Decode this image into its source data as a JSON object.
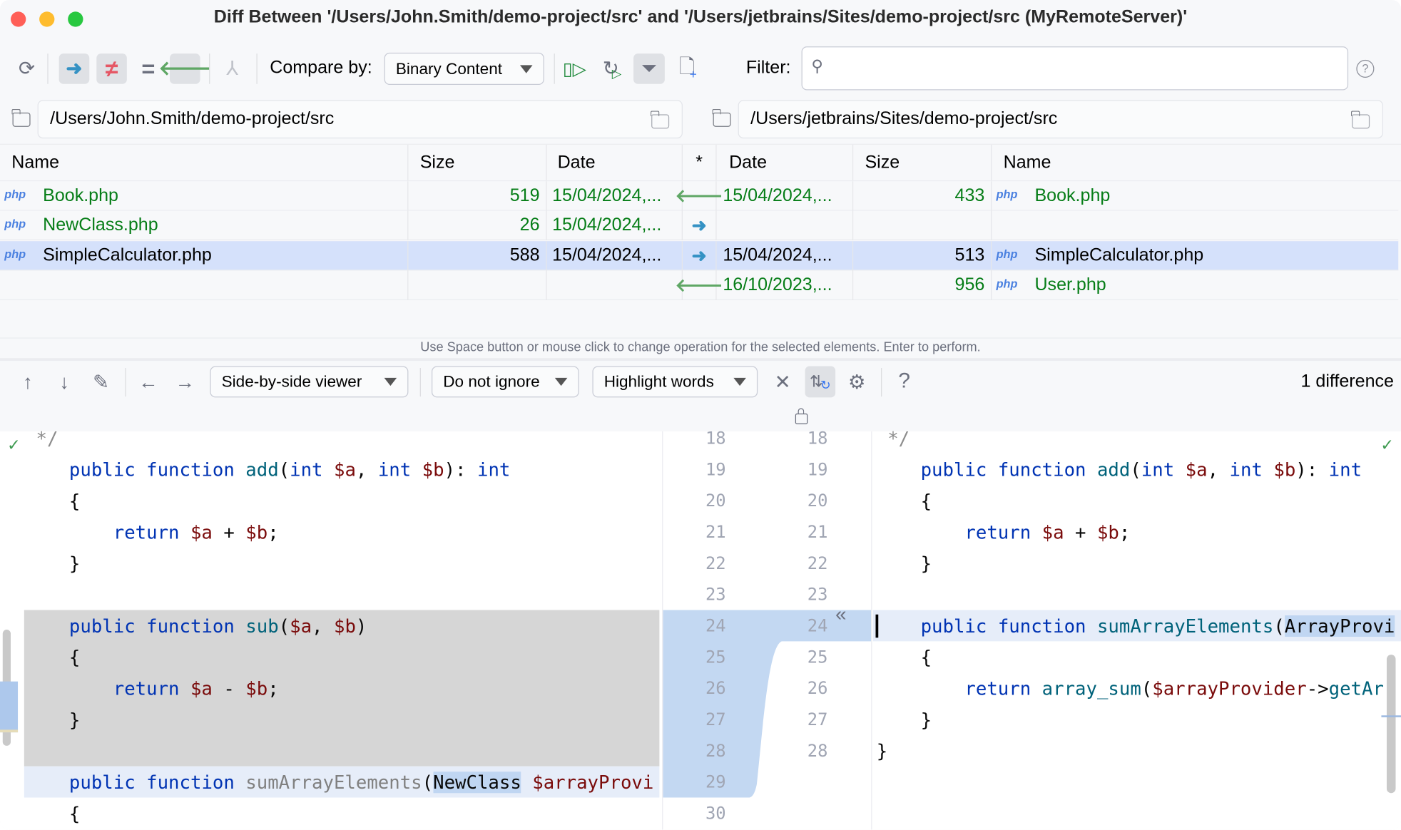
{
  "window": {
    "title": "Diff Between '/Users/John.Smith/demo-project/src' and '/Users/jetbrains/Sites/demo-project/src (MyRemoteServer)'"
  },
  "toolbar": {
    "compare_by_label": "Compare by:",
    "compare_by_value": "Binary Content",
    "filter_label": "Filter:",
    "filter_value": "",
    "filter_placeholder": "",
    "icons": [
      "refresh-icon",
      "show-left-to-right-icon",
      "show-different-icon",
      "show-equal-icon",
      "show-right-to-left-icon",
      "merge-icon",
      "synchronize-selected-icon",
      "synchronize-all-icon",
      "filter-icon",
      "new-file-icon",
      "help-icon"
    ]
  },
  "paths": {
    "left": "/Users/John.Smith/demo-project/src",
    "right": "/Users/jetbrains/Sites/demo-project/src"
  },
  "table": {
    "headers": [
      "Name",
      "Size",
      "Date",
      "*",
      "Date",
      "Size",
      "Name"
    ],
    "rows": [
      {
        "left_name": "Book.php",
        "left_size": "519",
        "left_date": "15/04/2024,...",
        "op": "left",
        "right_date": "15/04/2024,...",
        "right_size": "433",
        "right_name": "Book.php",
        "status": "different",
        "selected": false
      },
      {
        "left_name": "NewClass.php",
        "left_size": "26",
        "left_date": "15/04/2024,...",
        "op": "right",
        "right_date": "",
        "right_size": "",
        "right_name": "",
        "status": "left-only",
        "selected": false
      },
      {
        "left_name": "SimpleCalculator.php",
        "left_size": "588",
        "left_date": "15/04/2024,...",
        "op": "right",
        "right_date": "15/04/2024,...",
        "right_size": "513",
        "right_name": "SimpleCalculator.php",
        "status": "different",
        "selected": true
      },
      {
        "left_name": "",
        "left_size": "",
        "left_date": "",
        "op": "left",
        "right_date": "16/10/2023,...",
        "right_size": "956",
        "right_name": "User.php",
        "status": "right-only",
        "selected": false
      }
    ],
    "file_badge": "php",
    "hint": "Use Space button or mouse click to change operation for the selected elements. Enter to perform."
  },
  "diff_toolbar": {
    "viewer": "Side-by-side viewer",
    "ignore": "Do not ignore",
    "highlight": "Highlight words",
    "differences": "1 difference",
    "help": "?"
  },
  "colors": {
    "accent": "#3574f0",
    "added": "#067d17",
    "selection": "#d5e1fb",
    "changed_gutter": "#c3d8f2",
    "deleted_block": "#d6d6d6"
  },
  "left_lines": [
    18,
    19,
    20,
    21,
    22,
    23,
    24,
    25,
    26,
    27,
    28,
    29,
    30
  ],
  "right_lines": [
    18,
    19,
    20,
    21,
    22,
    23,
    24,
    25,
    26,
    27,
    28
  ],
  "left_code": [
    [
      [
        " */",
        "cm"
      ]
    ],
    [
      [
        "public ",
        "kw"
      ],
      [
        "function ",
        "kw"
      ],
      [
        "add",
        "fn"
      ],
      [
        "(",
        "pl"
      ],
      [
        "int ",
        "kw"
      ],
      [
        "$a",
        "var"
      ],
      [
        ", ",
        "pl"
      ],
      [
        "int ",
        "kw"
      ],
      [
        "$b",
        "var"
      ],
      [
        "): ",
        "pl"
      ],
      [
        "int",
        "kw"
      ]
    ],
    [
      [
        "{",
        "pl"
      ]
    ],
    [
      [
        "    return ",
        "kw"
      ],
      [
        "$a",
        "var"
      ],
      [
        " + ",
        "pl"
      ],
      [
        "$b",
        "var"
      ],
      [
        ";",
        "pl"
      ]
    ],
    [
      [
        "}",
        "pl"
      ]
    ],
    [],
    [
      [
        "public ",
        "kw"
      ],
      [
        "function ",
        "kw"
      ],
      [
        "sub",
        "fn"
      ],
      [
        "(",
        "pl"
      ],
      [
        "$a",
        "var"
      ],
      [
        ", ",
        "pl"
      ],
      [
        "$b",
        "var"
      ],
      [
        ")",
        "pl"
      ]
    ],
    [
      [
        "{",
        "pl"
      ]
    ],
    [
      [
        "    return ",
        "kw"
      ],
      [
        "$a",
        "var"
      ],
      [
        " - ",
        "pl"
      ],
      [
        "$b",
        "var"
      ],
      [
        ";",
        "pl"
      ]
    ],
    [
      [
        "}",
        "pl"
      ]
    ],
    [],
    [
      [
        "public ",
        "kw"
      ],
      [
        "function ",
        "kw"
      ],
      [
        "sumArrayElements",
        "gr"
      ],
      [
        "(",
        "pl"
      ],
      [
        "NewClass",
        "pl hl"
      ],
      [
        " ",
        "pl"
      ],
      [
        "$arrayProvi",
        "var"
      ]
    ],
    [
      [
        "{",
        "pl"
      ]
    ]
  ],
  "right_code": [
    [
      [
        " */",
        "cm"
      ]
    ],
    [
      [
        "public ",
        "kw"
      ],
      [
        "function ",
        "kw"
      ],
      [
        "add",
        "fn"
      ],
      [
        "(",
        "pl"
      ],
      [
        "int ",
        "kw"
      ],
      [
        "$a",
        "var"
      ],
      [
        ", ",
        "pl"
      ],
      [
        "int ",
        "kw"
      ],
      [
        "$b",
        "var"
      ],
      [
        "): ",
        "pl"
      ],
      [
        "int",
        "kw"
      ]
    ],
    [
      [
        "{",
        "pl"
      ]
    ],
    [
      [
        "    return ",
        "kw"
      ],
      [
        "$a",
        "var"
      ],
      [
        " + ",
        "pl"
      ],
      [
        "$b",
        "var"
      ],
      [
        ";",
        "pl"
      ]
    ],
    [
      [
        "}",
        "pl"
      ]
    ],
    [],
    [
      [
        "public ",
        "kw"
      ],
      [
        "function ",
        "kw"
      ],
      [
        "sumArrayElements",
        "fn"
      ],
      [
        "(",
        "pl"
      ],
      [
        "ArrayProvi",
        "pl hl"
      ]
    ],
    [
      [
        "{",
        "pl"
      ]
    ],
    [
      [
        "    return ",
        "kw"
      ],
      [
        "array_sum",
        "fn"
      ],
      [
        "(",
        "pl"
      ],
      [
        "$arrayProvider",
        "var"
      ],
      [
        "->",
        "pl"
      ],
      [
        "getArr",
        "fn"
      ]
    ],
    [
      [
        "}",
        "pl"
      ]
    ],
    [
      [
        "}",
        "pl"
      ]
    ]
  ]
}
